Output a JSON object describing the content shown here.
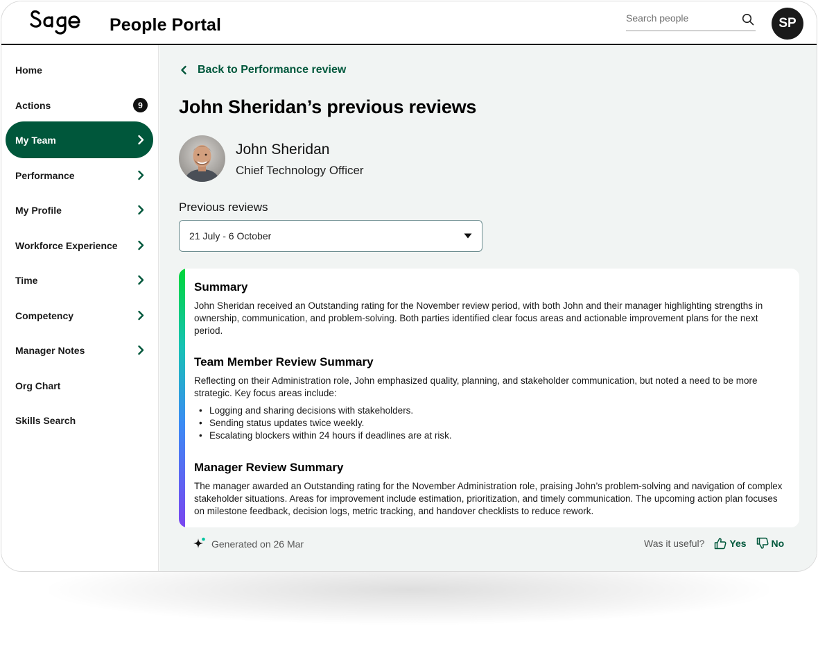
{
  "header": {
    "logo_text": "Sage",
    "title": "People Portal",
    "search_placeholder": "Search people",
    "search_icon": "search-icon",
    "user_initials": "SP"
  },
  "sidebar": {
    "items": [
      {
        "label": "Home"
      },
      {
        "label": "Actions",
        "badge": "9"
      },
      {
        "label": "My Team",
        "active": true,
        "icon": "chevron-right-icon"
      },
      {
        "label": "Performance",
        "icon": "chevron-right-icon"
      },
      {
        "label": "My Profile",
        "icon": "chevron-right-icon"
      },
      {
        "label": "Workforce Experience",
        "icon": "chevron-right-icon"
      },
      {
        "label": "Time",
        "icon": "chevron-right-icon"
      },
      {
        "label": "Competency",
        "icon": "chevron-right-icon"
      },
      {
        "label": "Manager Notes",
        "icon": "chevron-right-icon"
      },
      {
        "label": "Org Chart"
      },
      {
        "label": "Skills Search"
      }
    ]
  },
  "main": {
    "back_label": "Back to Performance review",
    "page_title": "John Sheridan’s previous reviews",
    "person": {
      "name": "John Sheridan",
      "role": "Chief Technology Officer"
    },
    "previous_reviews_label": "Previous reviews",
    "selected_period": "21 July - 6 October",
    "summary": {
      "title": "Summary",
      "body": "John Sheridan received an Outstanding rating for the November review period, with both John and their manager highlighting strengths in ownership, communication, and problem-solving. Both parties identified clear focus areas and actionable improvement plans for the next period."
    },
    "team_member": {
      "title": "Team Member Review Summary",
      "body": "Reflecting on their Administration role, John emphasized quality, planning, and stakeholder communication, but noted a need to be more strategic. Key focus areas include:",
      "bullets": [
        "Logging and sharing decisions with stakeholders.",
        "Sending status updates twice weekly.",
        "Escalating blockers within 24 hours if deadlines are at risk."
      ]
    },
    "manager": {
      "title": "Manager Review Summary",
      "body": "The manager awarded an Outstanding rating for the November Administration role, praising John’s problem-solving and navigation of complex stakeholder situations. Areas for improvement include estimation, prioritization, and timely communication. The upcoming action plan focuses on milestone feedback, decision logs, metric tracking, and handover checklists to reduce rework."
    },
    "generated_text": "Generated on 26 Mar",
    "feedback": {
      "question": "Was it useful?",
      "yes": "Yes",
      "no": "No"
    }
  },
  "colors": {
    "brand_green": "#00573b",
    "page_bg": "#f1f4f3",
    "accent_gradient": [
      "#00d639",
      "#17c2b3",
      "#3b8bf4",
      "#7a45f0"
    ]
  }
}
